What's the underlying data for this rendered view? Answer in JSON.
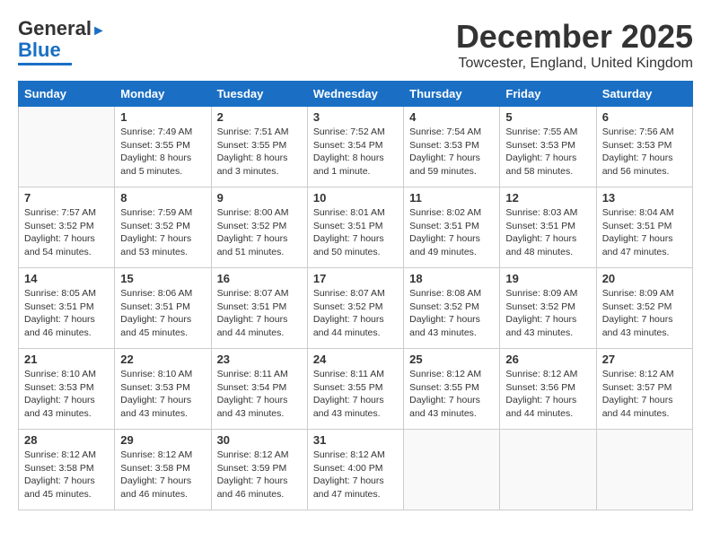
{
  "header": {
    "logo_general": "General",
    "logo_blue": "Blue",
    "month_title": "December 2025",
    "location": "Towcester, England, United Kingdom"
  },
  "days_of_week": [
    "Sunday",
    "Monday",
    "Tuesday",
    "Wednesday",
    "Thursday",
    "Friday",
    "Saturday"
  ],
  "weeks": [
    [
      {
        "day": "",
        "info": ""
      },
      {
        "day": "1",
        "info": "Sunrise: 7:49 AM\nSunset: 3:55 PM\nDaylight: 8 hours\nand 5 minutes."
      },
      {
        "day": "2",
        "info": "Sunrise: 7:51 AM\nSunset: 3:55 PM\nDaylight: 8 hours\nand 3 minutes."
      },
      {
        "day": "3",
        "info": "Sunrise: 7:52 AM\nSunset: 3:54 PM\nDaylight: 8 hours\nand 1 minute."
      },
      {
        "day": "4",
        "info": "Sunrise: 7:54 AM\nSunset: 3:53 PM\nDaylight: 7 hours\nand 59 minutes."
      },
      {
        "day": "5",
        "info": "Sunrise: 7:55 AM\nSunset: 3:53 PM\nDaylight: 7 hours\nand 58 minutes."
      },
      {
        "day": "6",
        "info": "Sunrise: 7:56 AM\nSunset: 3:53 PM\nDaylight: 7 hours\nand 56 minutes."
      }
    ],
    [
      {
        "day": "7",
        "info": "Sunrise: 7:57 AM\nSunset: 3:52 PM\nDaylight: 7 hours\nand 54 minutes."
      },
      {
        "day": "8",
        "info": "Sunrise: 7:59 AM\nSunset: 3:52 PM\nDaylight: 7 hours\nand 53 minutes."
      },
      {
        "day": "9",
        "info": "Sunrise: 8:00 AM\nSunset: 3:52 PM\nDaylight: 7 hours\nand 51 minutes."
      },
      {
        "day": "10",
        "info": "Sunrise: 8:01 AM\nSunset: 3:51 PM\nDaylight: 7 hours\nand 50 minutes."
      },
      {
        "day": "11",
        "info": "Sunrise: 8:02 AM\nSunset: 3:51 PM\nDaylight: 7 hours\nand 49 minutes."
      },
      {
        "day": "12",
        "info": "Sunrise: 8:03 AM\nSunset: 3:51 PM\nDaylight: 7 hours\nand 48 minutes."
      },
      {
        "day": "13",
        "info": "Sunrise: 8:04 AM\nSunset: 3:51 PM\nDaylight: 7 hours\nand 47 minutes."
      }
    ],
    [
      {
        "day": "14",
        "info": "Sunrise: 8:05 AM\nSunset: 3:51 PM\nDaylight: 7 hours\nand 46 minutes."
      },
      {
        "day": "15",
        "info": "Sunrise: 8:06 AM\nSunset: 3:51 PM\nDaylight: 7 hours\nand 45 minutes."
      },
      {
        "day": "16",
        "info": "Sunrise: 8:07 AM\nSunset: 3:51 PM\nDaylight: 7 hours\nand 44 minutes."
      },
      {
        "day": "17",
        "info": "Sunrise: 8:07 AM\nSunset: 3:52 PM\nDaylight: 7 hours\nand 44 minutes."
      },
      {
        "day": "18",
        "info": "Sunrise: 8:08 AM\nSunset: 3:52 PM\nDaylight: 7 hours\nand 43 minutes."
      },
      {
        "day": "19",
        "info": "Sunrise: 8:09 AM\nSunset: 3:52 PM\nDaylight: 7 hours\nand 43 minutes."
      },
      {
        "day": "20",
        "info": "Sunrise: 8:09 AM\nSunset: 3:52 PM\nDaylight: 7 hours\nand 43 minutes."
      }
    ],
    [
      {
        "day": "21",
        "info": "Sunrise: 8:10 AM\nSunset: 3:53 PM\nDaylight: 7 hours\nand 43 minutes."
      },
      {
        "day": "22",
        "info": "Sunrise: 8:10 AM\nSunset: 3:53 PM\nDaylight: 7 hours\nand 43 minutes."
      },
      {
        "day": "23",
        "info": "Sunrise: 8:11 AM\nSunset: 3:54 PM\nDaylight: 7 hours\nand 43 minutes."
      },
      {
        "day": "24",
        "info": "Sunrise: 8:11 AM\nSunset: 3:55 PM\nDaylight: 7 hours\nand 43 minutes."
      },
      {
        "day": "25",
        "info": "Sunrise: 8:12 AM\nSunset: 3:55 PM\nDaylight: 7 hours\nand 43 minutes."
      },
      {
        "day": "26",
        "info": "Sunrise: 8:12 AM\nSunset: 3:56 PM\nDaylight: 7 hours\nand 44 minutes."
      },
      {
        "day": "27",
        "info": "Sunrise: 8:12 AM\nSunset: 3:57 PM\nDaylight: 7 hours\nand 44 minutes."
      }
    ],
    [
      {
        "day": "28",
        "info": "Sunrise: 8:12 AM\nSunset: 3:58 PM\nDaylight: 7 hours\nand 45 minutes."
      },
      {
        "day": "29",
        "info": "Sunrise: 8:12 AM\nSunset: 3:58 PM\nDaylight: 7 hours\nand 46 minutes."
      },
      {
        "day": "30",
        "info": "Sunrise: 8:12 AM\nSunset: 3:59 PM\nDaylight: 7 hours\nand 46 minutes."
      },
      {
        "day": "31",
        "info": "Sunrise: 8:12 AM\nSunset: 4:00 PM\nDaylight: 7 hours\nand 47 minutes."
      },
      {
        "day": "",
        "info": ""
      },
      {
        "day": "",
        "info": ""
      },
      {
        "day": "",
        "info": ""
      }
    ]
  ]
}
